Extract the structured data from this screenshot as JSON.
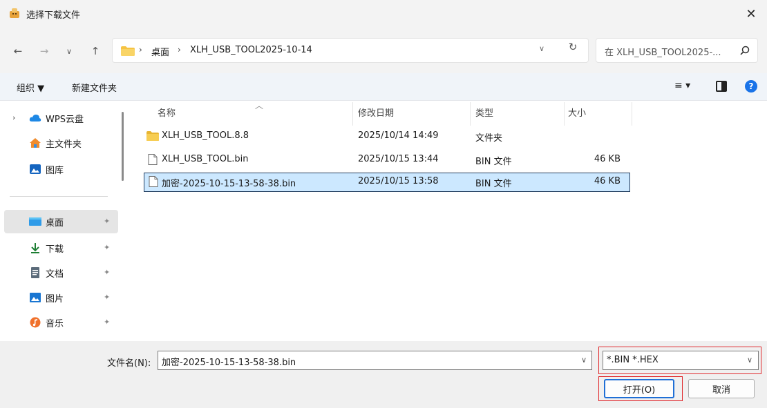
{
  "window": {
    "title": "选择下载文件",
    "close_icon": "close-icon",
    "app_icon": "app-icon"
  },
  "nav": {
    "back_icon": "arrow-left-icon",
    "forward_icon": "arrow-right-icon",
    "recent_icon": "chevron-down-icon",
    "up_icon": "arrow-up-icon",
    "breadcrumb": [
      "桌面",
      "XLH_USB_TOOL2025-10-14"
    ],
    "refresh_icon": "refresh-icon",
    "search_placeholder": "在 XLH_USB_TOOL2025-..."
  },
  "commandbar": {
    "organize": "组织 ▼",
    "new_folder": "新建文件夹",
    "view_icon": "view-list-icon",
    "preview_pane_icon": "preview-pane-icon",
    "help_icon": "help-icon",
    "help_glyph": "?"
  },
  "sidebar": {
    "items": [
      {
        "label": "WPS云盘",
        "icon": "cloud-icon",
        "expandable": true
      },
      {
        "label": "主文件夹",
        "icon": "home-icon"
      },
      {
        "label": "图库",
        "icon": "gallery-icon"
      },
      {
        "label": "桌面",
        "icon": "desktop-icon",
        "pinned": true,
        "active": true
      },
      {
        "label": "下载",
        "icon": "download-icon",
        "pinned": true
      },
      {
        "label": "文档",
        "icon": "document-icon",
        "pinned": true
      },
      {
        "label": "图片",
        "icon": "pictures-icon",
        "pinned": true
      },
      {
        "label": "音乐",
        "icon": "music-icon",
        "pinned": true
      }
    ]
  },
  "filelist": {
    "columns": [
      "名称",
      "修改日期",
      "类型",
      "大小"
    ],
    "rows": [
      {
        "name": "XLH_USB_TOOL.8.8",
        "modified": "2025/10/14 14:49",
        "type": "文件夹",
        "size": "",
        "icon": "folder-icon",
        "selected": false
      },
      {
        "name": "XLH_USB_TOOL.bin",
        "modified": "2025/10/15 13:44",
        "type": "BIN 文件",
        "size": "46 KB",
        "icon": "file-icon",
        "selected": false
      },
      {
        "name": "加密-2025-10-15-13-58-38.bin",
        "modified": "2025/10/15 13:58",
        "type": "BIN 文件",
        "size": "46 KB",
        "icon": "file-icon",
        "selected": true
      }
    ]
  },
  "bottom": {
    "filename_label": "文件名(N):",
    "filename_value": "加密-2025-10-15-13-58-38.bin",
    "filter_value": "*.BIN *.HEX",
    "open_label": "打开(O)",
    "cancel_label": "取消"
  },
  "colors": {
    "selection_bg": "#cce8ff",
    "highlight_box": "#e0272b",
    "primary_button_border": "#1f6fd6",
    "folder": "#f6c342"
  }
}
